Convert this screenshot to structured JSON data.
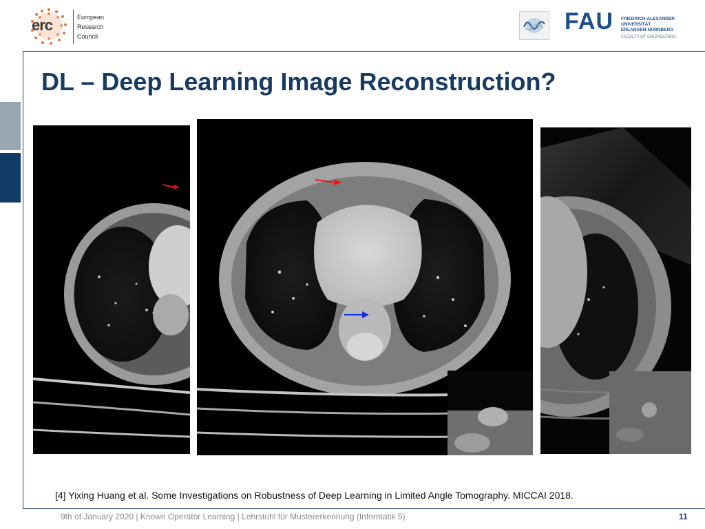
{
  "header": {
    "erc": {
      "mark": "erc",
      "line1": "European",
      "line2": "Research",
      "line3": "Council"
    },
    "fau": {
      "mark": "FAU",
      "line1": "FRIEDRICH-ALEXANDER",
      "line2": "UNIVERSITÄT",
      "line3": "ERLANGEN-NÜRNBERG",
      "faculty": "FACULTY OF ENGINEERING"
    },
    "lme_logo_icon": "sine-wave-logo-icon"
  },
  "slide": {
    "title": "DL – Deep Learning Image Reconstruction?",
    "reference": "[4] Yixing Huang et al. Some Investigations on Robustness of Deep Learning in Limited Angle Tomography. MICCAI 2018."
  },
  "figure": {
    "panels": [
      "ct-scan-left",
      "ct-scan-center",
      "ct-scan-right"
    ],
    "arrow_colors": {
      "red": "#e0191b",
      "blue": "#1530e6"
    }
  },
  "footer": {
    "text": "9th of January 2020 | Known Operator Learning | Lehrstuhl für Mustererkennung (Informatik 5)",
    "page_number": "11"
  },
  "colors": {
    "title": "#183b63",
    "rule": "#1f3f66",
    "tab_light": "#9aa7b3",
    "tab_dark": "#123a66"
  }
}
